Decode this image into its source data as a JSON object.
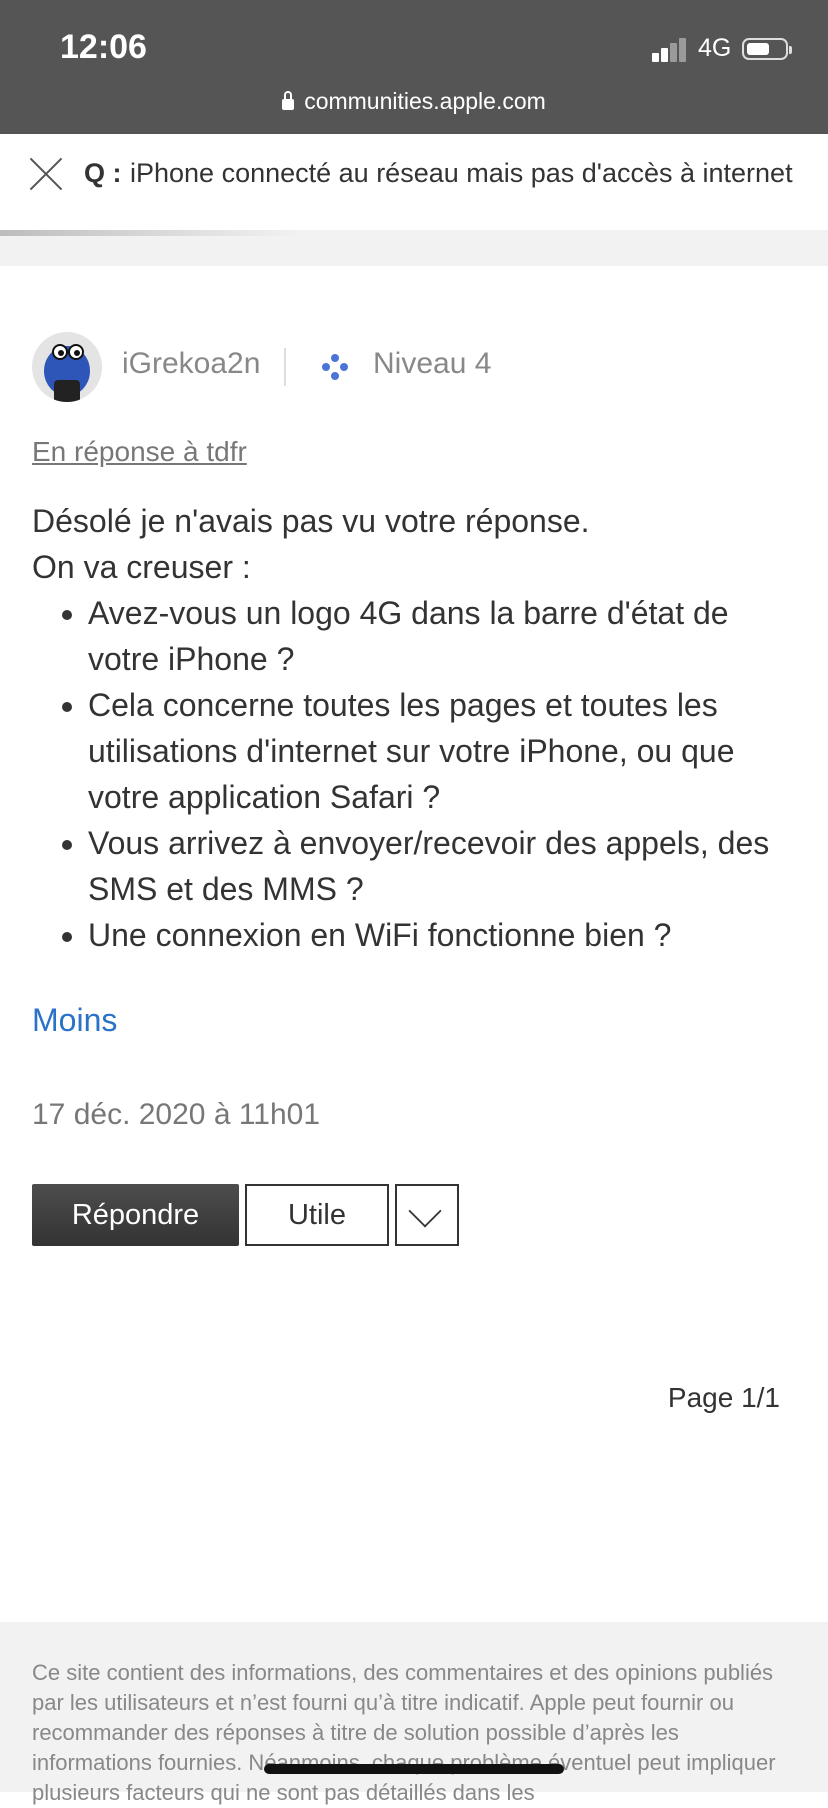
{
  "status_bar": {
    "time": "12:06",
    "network": "4G",
    "url": "communities.apple.com"
  },
  "question": {
    "label": "Q :",
    "title": "iPhone connecté au réseau mais pas d'accès à internet"
  },
  "post": {
    "author": "iGrekoa2n",
    "level": "Niveau 4",
    "in_reply_to": "En réponse à tdfr",
    "paragraph1": "Désolé je n'avais pas vu votre réponse.",
    "paragraph2": "On va creuser :",
    "bullets": [
      "Avez-vous un logo 4G dans la barre d'état de votre iPhone ?",
      "Cela concerne toutes les pages et toutes les utilisations d'internet sur votre iPhone, ou que votre application Safari ?",
      "Vous arrivez à envoyer/recevoir des appels, des SMS et des MMS ?",
      "Une connexion en WiFi fonctionne bien ?"
    ],
    "less_link": "Moins",
    "date": "17 déc. 2020 à 11h01"
  },
  "actions": {
    "reply_label": "Répondre",
    "useful_label": "Utile"
  },
  "pagination": {
    "label": "Page 1/1"
  },
  "footer": {
    "text": "Ce site contient des informations, des commentaires et des opinions publiés par les utilisateurs et n’est fourni qu’à titre indicatif. Apple peut fournir ou recommander des réponses à titre de solution possible d’après les informations fournies. Néanmoins, chaque problème éventuel peut impliquer plusieurs facteurs qui ne sont pas détaillés dans les"
  },
  "colors": {
    "top_bar": "#555555",
    "link_blue": "#2a72c8",
    "level_icon": "#4a74d6",
    "footer_bg": "#f2f2f2"
  },
  "icons": [
    "lock-icon",
    "close-icon",
    "level-icon",
    "chevron-down-icon",
    "signal-icon",
    "battery-icon"
  ]
}
